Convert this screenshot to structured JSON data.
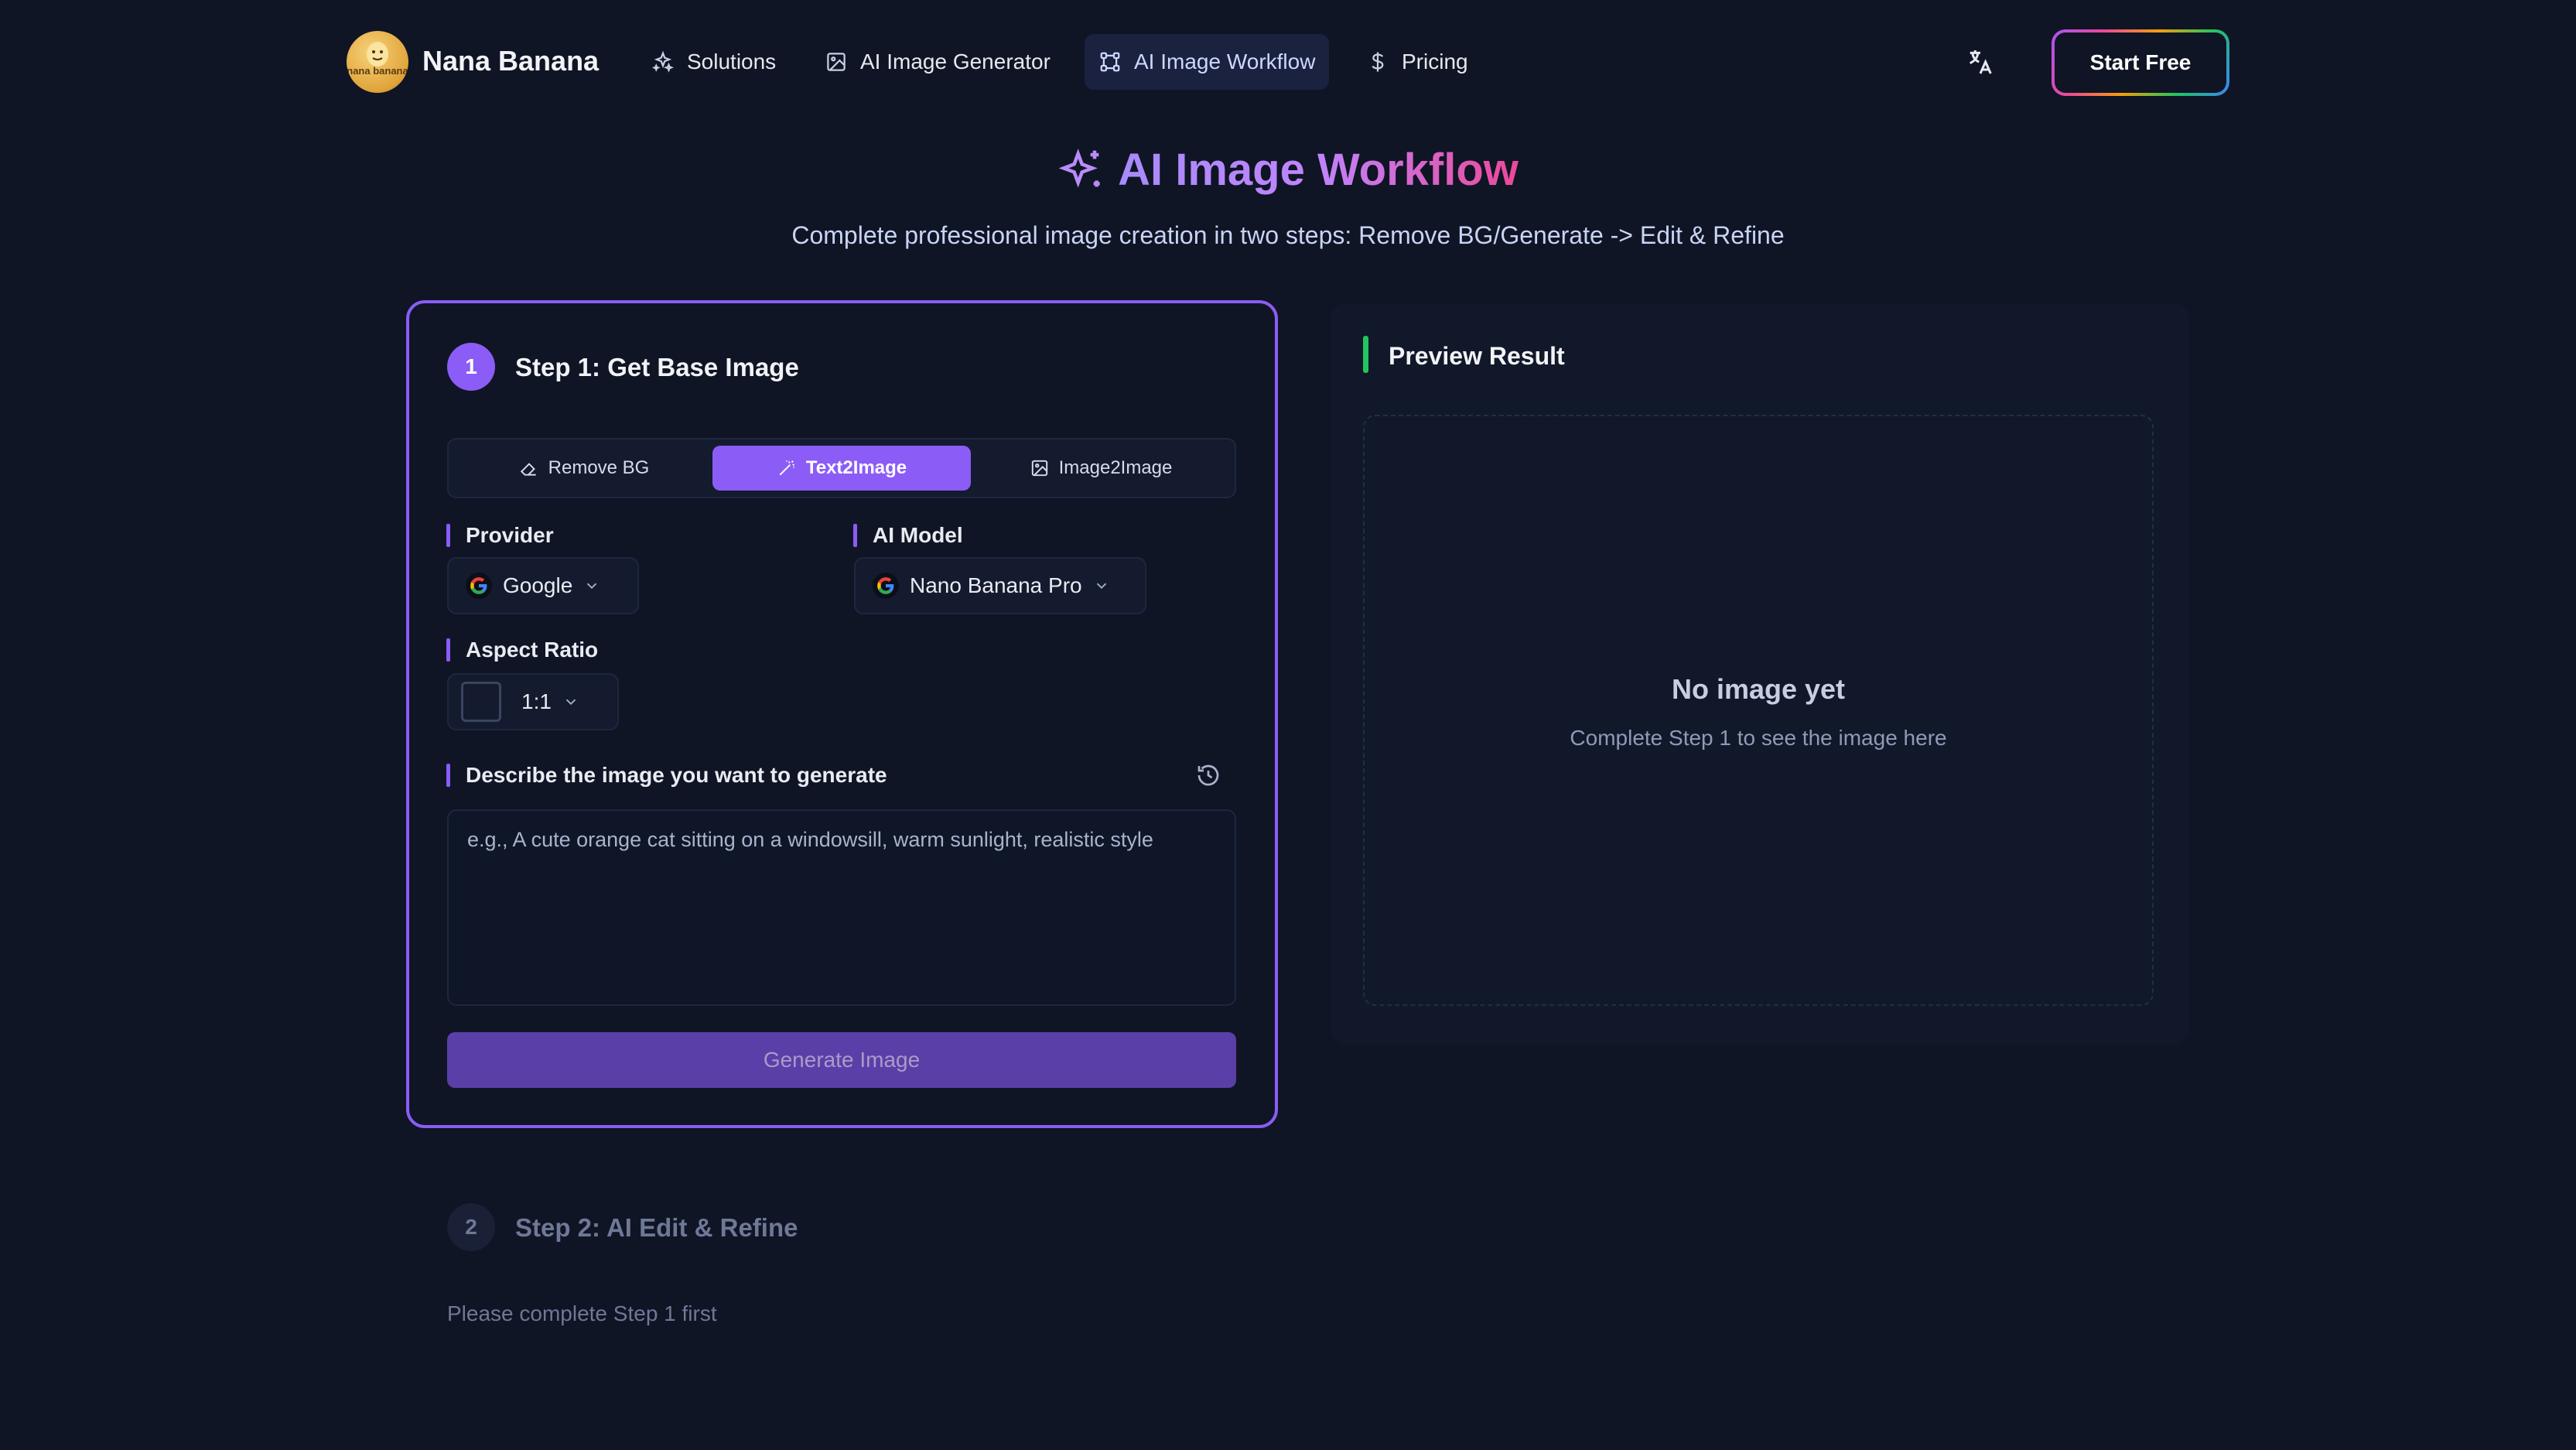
{
  "brand": {
    "name": "Nana Banana",
    "logo_text": "nana banana"
  },
  "nav": {
    "items": [
      {
        "label": "Solutions",
        "icon": "sparkles-icon"
      },
      {
        "label": "AI Image Generator",
        "icon": "image-icon"
      },
      {
        "label": "AI Image Workflow",
        "icon": "workflow-icon",
        "active": true
      },
      {
        "label": "Pricing",
        "icon": "dollar-icon"
      }
    ],
    "translate_icon": "translate-icon",
    "cta_label": "Start Free"
  },
  "hero": {
    "title": "AI Image Workflow",
    "subtitle": "Complete professional image creation in two steps: Remove BG/Generate -> Edit & Refine"
  },
  "step1": {
    "number": "1",
    "title": "Step 1: Get Base Image",
    "tabs": [
      {
        "label": "Remove BG",
        "icon": "eraser-icon"
      },
      {
        "label": "Text2Image",
        "icon": "magic-wand-icon",
        "active": true
      },
      {
        "label": "Image2Image",
        "icon": "image-icon"
      }
    ],
    "provider": {
      "label": "Provider",
      "value": "Google"
    },
    "model": {
      "label": "AI Model",
      "value": "Nano Banana Pro"
    },
    "aspect": {
      "label": "Aspect Ratio",
      "value": "1:1"
    },
    "prompt": {
      "label": "Describe the image you want to generate",
      "placeholder": "e.g., A cute orange cat sitting on a windowsill, warm sunlight, realistic style",
      "value": ""
    },
    "generate_label": "Generate Image"
  },
  "preview": {
    "title": "Preview Result",
    "empty_title": "No image yet",
    "empty_subtitle": "Complete Step 1 to see the image here"
  },
  "step2": {
    "number": "2",
    "title": "Step 2: AI Edit & Refine",
    "hint": "Please complete Step 1 first"
  },
  "colors": {
    "background": "#0f1524",
    "accent": "#8b5cf6",
    "preview_accent": "#22c55e",
    "button_disabled": "#5b3fa8"
  }
}
